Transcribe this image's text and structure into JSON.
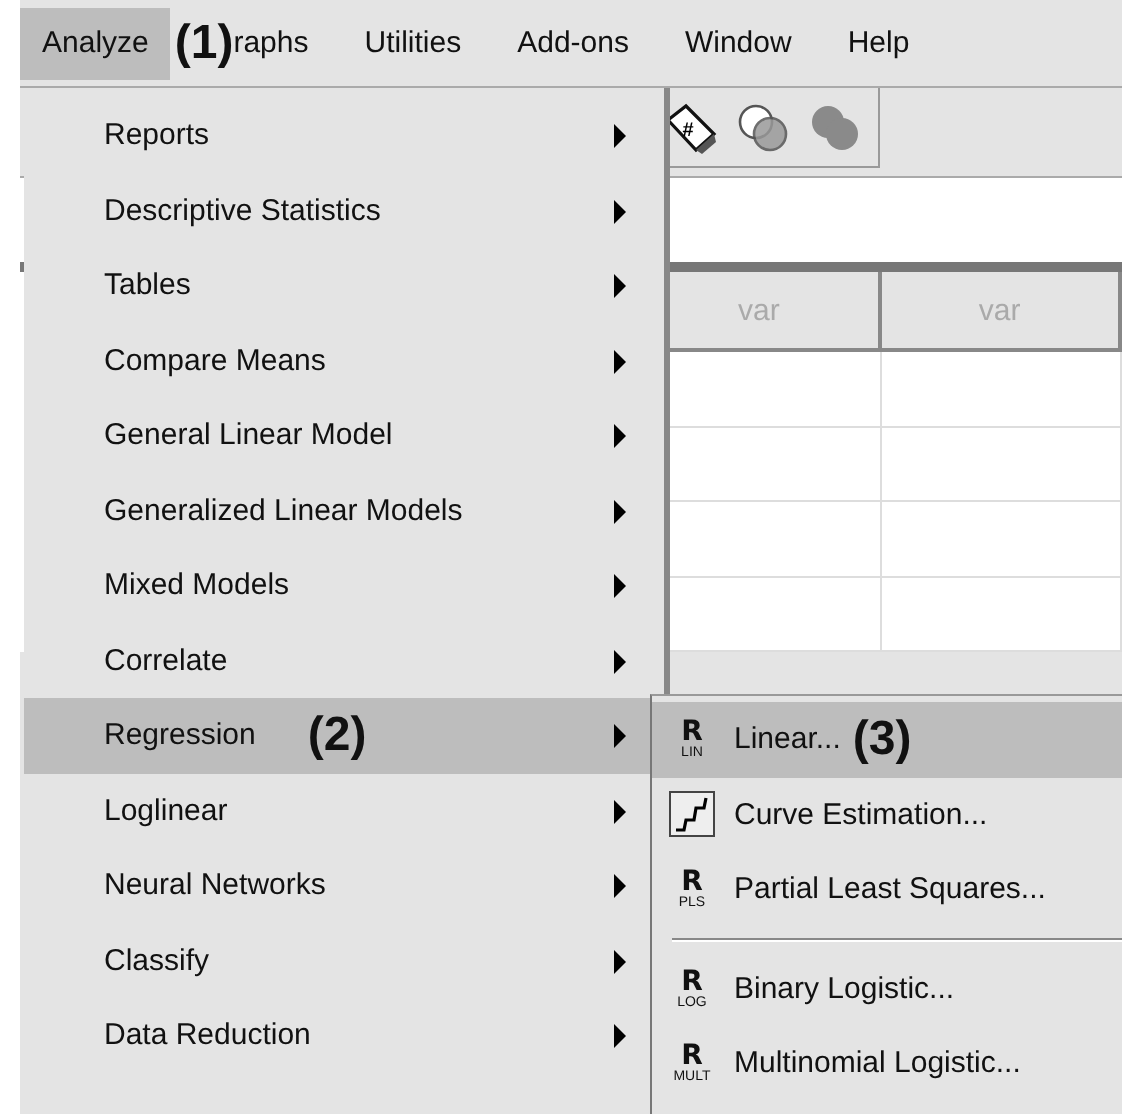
{
  "menu_bar": {
    "annotation": "(1)",
    "items": [
      {
        "label": "Analyze",
        "selected": true
      },
      {
        "label": "raphs",
        "selected": false
      },
      {
        "label": "Utilities",
        "selected": false
      },
      {
        "label": "Add-ons",
        "selected": false
      },
      {
        "label": "Window",
        "selected": false
      },
      {
        "label": "Help",
        "selected": false
      }
    ]
  },
  "toolbar": {
    "icons": [
      {
        "kind": "tag",
        "text": "#"
      },
      {
        "kind": "circles-outline"
      },
      {
        "kind": "circles-filled"
      }
    ]
  },
  "grid": {
    "columns": [
      "var",
      "var"
    ]
  },
  "analyze_menu": {
    "items": [
      {
        "label": "Reports",
        "selected": false
      },
      {
        "label": "Descriptive Statistics",
        "selected": false
      },
      {
        "label": "Tables",
        "selected": false
      },
      {
        "label": "Compare Means",
        "selected": false
      },
      {
        "label": "General Linear Model",
        "selected": false
      },
      {
        "label": "Generalized Linear Models",
        "selected": false
      },
      {
        "label": "Mixed Models",
        "selected": false
      },
      {
        "label": "Correlate",
        "selected": false
      },
      {
        "label": "Regression",
        "selected": true,
        "annotation": "(2)"
      },
      {
        "label": "Loglinear",
        "selected": false
      },
      {
        "label": "Neural Networks",
        "selected": false
      },
      {
        "label": "Classify",
        "selected": false
      },
      {
        "label": "Data Reduction",
        "selected": false
      }
    ]
  },
  "regression_menu": {
    "items": [
      {
        "kind": "item",
        "label": "Linear...",
        "selected": true,
        "annotation": "(3)",
        "icon": {
          "kind": "r-badge",
          "text": "R",
          "sub": "LIN"
        }
      },
      {
        "kind": "item",
        "label": "Curve Estimation...",
        "selected": false,
        "icon": {
          "kind": "curve"
        }
      },
      {
        "kind": "item",
        "label": "Partial Least Squares...",
        "selected": false,
        "icon": {
          "kind": "r-badge",
          "text": "R",
          "sub": "PLS"
        }
      },
      {
        "kind": "separator"
      },
      {
        "kind": "item",
        "label": "Binary Logistic...",
        "selected": false,
        "icon": {
          "kind": "r-badge",
          "text": "R",
          "sub": "LOG"
        }
      },
      {
        "kind": "item",
        "label": "Multinomial Logistic...",
        "selected": false,
        "icon": {
          "kind": "r-badge",
          "text": "R",
          "sub": "MULT"
        }
      }
    ]
  }
}
